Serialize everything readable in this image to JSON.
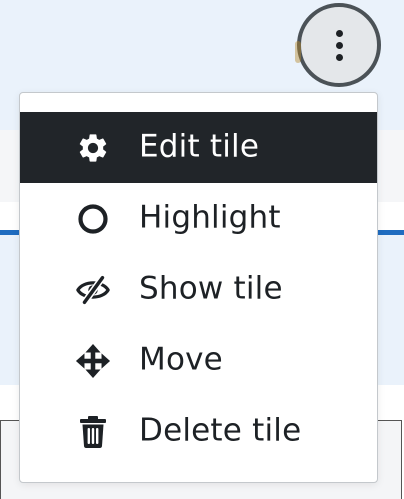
{
  "menu": {
    "items": [
      {
        "label": "Edit tile",
        "icon": "gear-icon",
        "active": true
      },
      {
        "label": "Highlight",
        "icon": "circle-outline-icon",
        "active": false
      },
      {
        "label": "Show tile",
        "icon": "eye-slash-icon",
        "active": false
      },
      {
        "label": "Move",
        "icon": "arrows-move-icon",
        "active": false
      },
      {
        "label": "Delete tile",
        "icon": "trash-icon",
        "active": false
      }
    ]
  },
  "colors": {
    "active_bg": "#212529",
    "active_text": "#ffffff",
    "text": "#1d2125",
    "page_band": "#eaf2fb",
    "accent_line": "#1f6cc0"
  }
}
